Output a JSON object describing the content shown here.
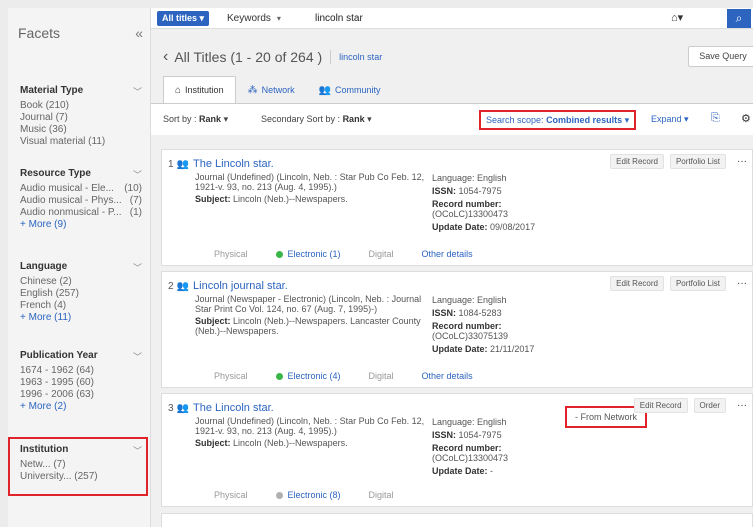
{
  "sidebar": {
    "title": "Facets",
    "facets": [
      {
        "title": "Material Type",
        "items": [
          {
            "label": "Book (210)",
            "count": ""
          },
          {
            "label": "Journal (7)",
            "count": ""
          },
          {
            "label": "Music (36)",
            "count": ""
          },
          {
            "label": "Visual material (11)",
            "count": ""
          }
        ],
        "more": ""
      },
      {
        "title": "Resource Type",
        "items": [
          {
            "label": "Audio musical - Ele...",
            "count": "(10)"
          },
          {
            "label": "Audio musical - Phys...",
            "count": "(7)"
          },
          {
            "label": "Audio nonmusical - P...",
            "count": "(1)"
          }
        ],
        "more": "+ More (9)"
      },
      {
        "title": "Language",
        "items": [
          {
            "label": "Chinese (2)",
            "count": ""
          },
          {
            "label": "English (257)",
            "count": ""
          },
          {
            "label": "French (4)",
            "count": ""
          }
        ],
        "more": "+ More (11)"
      },
      {
        "title": "Publication Year",
        "items": [
          {
            "label": "1674 - 1962 (64)",
            "count": ""
          },
          {
            "label": "1963 - 1995 (60)",
            "count": ""
          },
          {
            "label": "1996 - 2006 (63)",
            "count": ""
          }
        ],
        "more": "+ More (2)"
      },
      {
        "title": "Institution",
        "items": [
          {
            "label": "Netw... (7)",
            "count": ""
          },
          {
            "label": "University... (257)",
            "count": ""
          }
        ],
        "more": ""
      }
    ]
  },
  "topbar": {
    "scope": "All titles ▾",
    "field": "Keywords",
    "query": "lincoln star"
  },
  "header": {
    "title": "All Titles (1 - 20 of 264 )",
    "query": "lincoln star",
    "save_query": "Save Query"
  },
  "tabs": [
    {
      "label": "Institution",
      "icon": "home-icon"
    },
    {
      "label": "Network",
      "icon": "network-icon"
    },
    {
      "label": "Community",
      "icon": "community-icon"
    }
  ],
  "sortbar": {
    "sort_by_label": "Sort by :",
    "sort_by_value": "Rank",
    "secondary_label": "Secondary Sort by :",
    "secondary_value": "Rank",
    "search_scope_label": "Search scope:",
    "search_scope_value": "Combined results",
    "expand": "Expand"
  },
  "records": [
    {
      "num": "1",
      "title": "The Lincoln star.",
      "desc": "Journal (Undefined) (Lincoln, Neb. : Star Pub Co Feb. 12, 1921-v. 93, no. 213 (Aug. 4, 1995).)",
      "subject_label": "Subject:",
      "subject": "Lincoln (Neb.)--Newspapers.",
      "language": "Language: English",
      "issn_label": "ISSN:",
      "issn": "1054-7975",
      "record_number_label": "Record number:",
      "record_number": "(OCoLC)13300473",
      "update_label": "Update Date:",
      "update": "09/08/2017",
      "actions": [
        "Edit Record",
        "Portfolio List"
      ],
      "physical": "Physical",
      "electronic": "Electronic (1)",
      "digital": "Digital",
      "other": "Other details"
    },
    {
      "num": "2",
      "title": "Lincoln journal star.",
      "desc": "Journal (Newspaper - Electronic) (Lincoln, Neb. : Journal Star Print Co Vol. 124, no. 67 (Aug. 7, 1995)-)",
      "subject_label": "Subject:",
      "subject": "Lincoln (Neb.)--Newspapers. Lancaster County (Neb.)--Newspapers.",
      "language": "Language: English",
      "issn_label": "ISSN:",
      "issn": "1084-5283",
      "record_number_label": "Record number:",
      "record_number": "(OCoLC)33075139",
      "update_label": "Update Date:",
      "update": "21/11/2017",
      "actions": [
        "Edit Record",
        "Portfolio List"
      ],
      "physical": "Physical",
      "electronic": "Electronic (4)",
      "digital": "Digital",
      "other": "Other details"
    },
    {
      "num": "3",
      "title": "The Lincoln star.",
      "desc": "Journal (Undefined) (Lincoln, Neb. : Star Pub Co Feb. 12, 1921-v. 93, no. 213 (Aug. 4, 1995).)",
      "subject_label": "Subject:",
      "subject": "Lincoln (Neb.)--Newspapers.",
      "language": "Language: English",
      "issn_label": "ISSN:",
      "issn": "1054-7975",
      "record_number_label": "Record number:",
      "record_number": "(OCoLC)13300473",
      "update_label": "Update Date:",
      "update": "-",
      "actions": [
        "Edit Record",
        "Order"
      ],
      "physical": "Physical",
      "electronic": "Electronic (8)",
      "digital": "Digital",
      "other": "",
      "from_network": "- From Network"
    }
  ],
  "colors": {
    "accent": "#2c64c0",
    "highlight": "#e0232a",
    "available": "#3bb54a"
  }
}
